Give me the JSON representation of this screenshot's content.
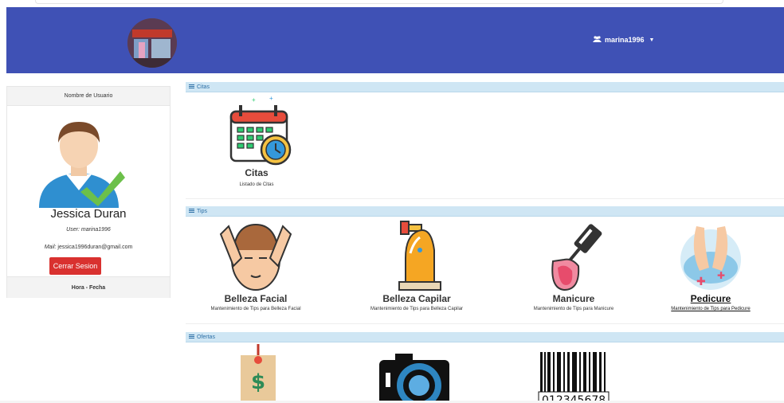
{
  "navbar": {
    "user_label": "marina1996",
    "user_icon": "users-icon",
    "brand_color": "#3f51b5"
  },
  "profile": {
    "header": "Nombre de Usuario",
    "name": "Jessica Duran",
    "user_prefix": "User:",
    "user_value": "marina1996",
    "mail_prefix": "Mail:",
    "mail_value": "jessica1996duran@gmail.com",
    "logout_label": "Cerrar Sesion",
    "footer": "Hora - Fecha"
  },
  "sections": {
    "citas": {
      "label": "Citas"
    },
    "tips": {
      "label": "Tips"
    },
    "ofertas": {
      "label": "Ofertas"
    }
  },
  "citas_cards": [
    {
      "title": "Citas",
      "desc": "Listado de Citas",
      "icon": "calendar-clock-icon"
    }
  ],
  "tips_cards": [
    {
      "title": "Belleza Facial",
      "desc": "Mantenimiento de Tips para Belleza Facial",
      "icon": "facial-massage-icon"
    },
    {
      "title": "Belleza Capilar",
      "desc": "Mantenimiento de Tips para Belleza Capilar",
      "icon": "hair-treatment-icon"
    },
    {
      "title": "Manicure",
      "desc": "Mantenimiento de Tips para Manicure",
      "icon": "nail-polish-icon"
    },
    {
      "title": "Pedicure",
      "desc": "Mantenimiento de Tips para Pedicure",
      "icon": "foot-spa-icon"
    }
  ],
  "ofertas_icons": [
    "price-tag-icon",
    "camera-icon",
    "barcode-icon"
  ],
  "barcode_number": "012345678",
  "colors": {
    "section_bar": "#cfe6f4",
    "logout": "#d9312f"
  }
}
